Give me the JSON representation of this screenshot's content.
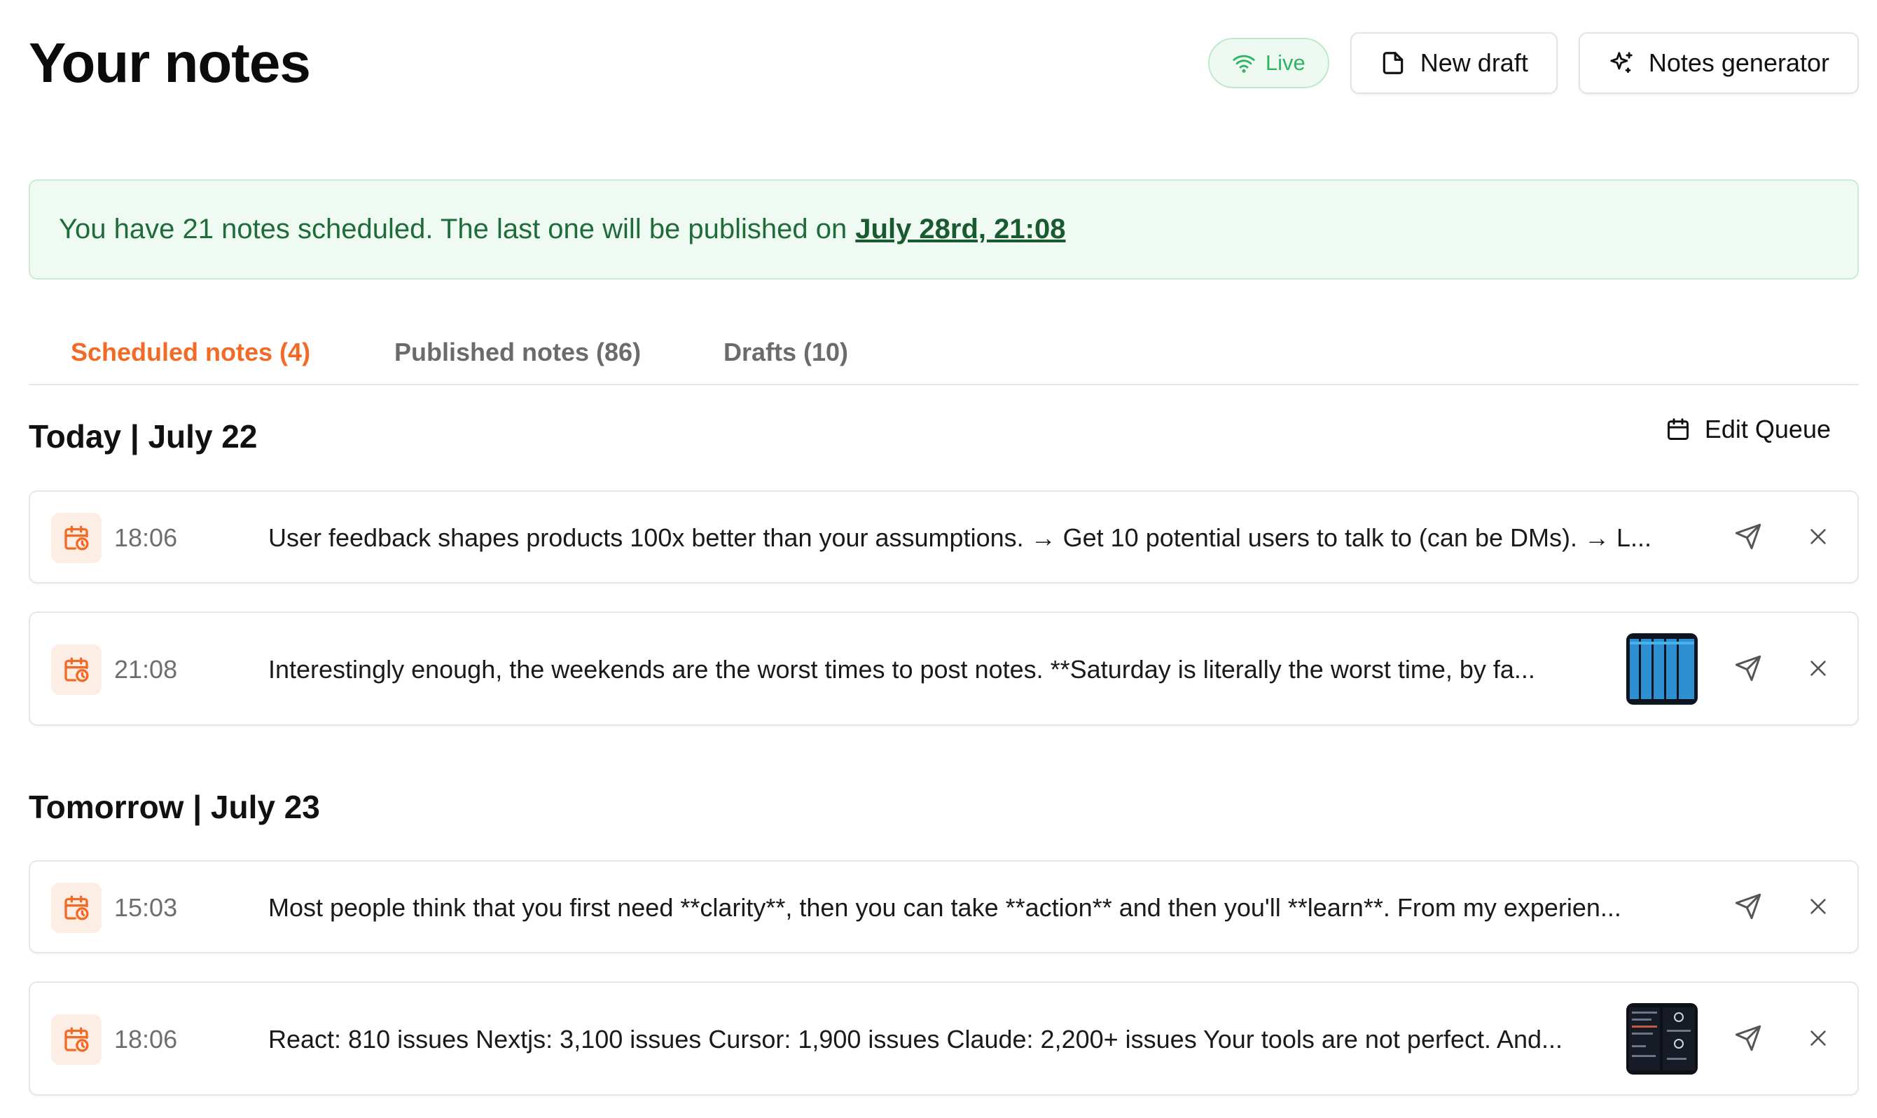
{
  "header": {
    "title": "Your notes",
    "live_label": "Live",
    "new_draft_label": "New draft",
    "generator_label": "Notes generator"
  },
  "banner": {
    "text": "You have 21 notes scheduled. The last one will be published on",
    "link": "July 28rd, 21:08"
  },
  "tabs": [
    {
      "label": "Scheduled notes (4)",
      "active": true
    },
    {
      "label": "Published notes (86)",
      "active": false
    },
    {
      "label": "Drafts (10)",
      "active": false
    }
  ],
  "sections": [
    {
      "title": "Today | July 22",
      "edit_label": "Edit Queue",
      "notes": [
        {
          "time": "18:06",
          "text": "User feedback shapes products 100x better than your assumptions. → Get 10 potential users to talk to (can be DMs). → L...",
          "has_image": false
        },
        {
          "time": "21:08",
          "text": "Interestingly enough, the weekends are the worst times to post notes. **Saturday is literally the worst time, by fa...",
          "has_image": true
        }
      ]
    },
    {
      "title": "Tomorrow | July 23",
      "notes": [
        {
          "time": "15:03",
          "text": "Most people think that you first need **clarity**, then you can take **action** and then you'll **learn**. From my experien...",
          "has_image": false
        },
        {
          "time": "18:06",
          "text": "React: 810 issues Nextjs: 3,100 issues Cursor: 1,900 issues Claude: 2,200+ issues Your tools are not perfect. And...",
          "has_image": true
        }
      ]
    }
  ],
  "icons": {
    "live": "wifi-icon",
    "new_draft": "file-icon",
    "generator": "sparkles-icon",
    "edit_queue": "calendar-icon",
    "note_status": "calendar-clock-icon",
    "send": "send-icon",
    "remove": "close-icon"
  },
  "colors": {
    "accent": "#f26a25",
    "live_green": "#2fb562",
    "banner_bg": "#effbf2",
    "banner_text": "#1f6c3b"
  }
}
